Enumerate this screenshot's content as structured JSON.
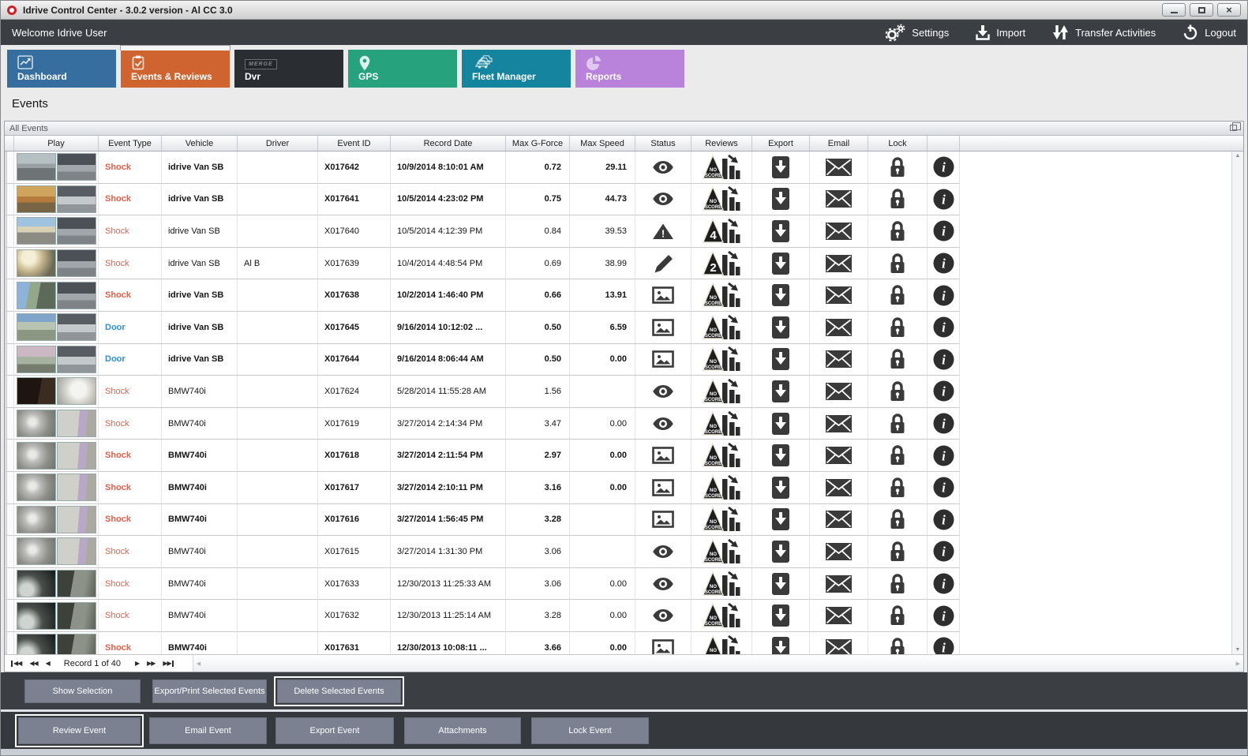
{
  "window": {
    "title": "Idrive Control Center - 3.0.2 version - Al CC 3.0",
    "controls": {
      "minimize": "minimize-button",
      "maximize": "maximize-button",
      "close": "close-button"
    }
  },
  "topbar": {
    "welcome": "Welcome Idrive User",
    "actions": [
      {
        "label": "Settings",
        "icon": "gears-icon"
      },
      {
        "label": "Import",
        "icon": "import-arrow-icon"
      },
      {
        "label": "Transfer Activities",
        "icon": "transfer-arrows-icon"
      },
      {
        "label": "Logout",
        "icon": "power-icon"
      }
    ]
  },
  "tabs": [
    {
      "label": "Dashboard",
      "icon": "line-chart-icon",
      "color": "#366f9f",
      "active": false
    },
    {
      "label": "Events & Reviews",
      "icon": "clipboard-check-icon",
      "color": "#cf6430",
      "active": true
    },
    {
      "label": "Dvr",
      "icon": "merge-logo-icon",
      "color": "#2a2d32",
      "active": false
    },
    {
      "label": "GPS",
      "icon": "map-pin-icon",
      "color": "#26a37d",
      "active": false
    },
    {
      "label": "Fleet Manager",
      "icon": "cars-icon",
      "color": "#15849e",
      "active": false
    },
    {
      "label": "Reports",
      "icon": "pie-chart-icon",
      "color": "#b983dc",
      "active": false
    }
  ],
  "page": {
    "heading": "Events",
    "panel_title": "All Events"
  },
  "table": {
    "columns": [
      "Play",
      "Event Type",
      "Vehicle",
      "Driver",
      "Event ID",
      "Record Date",
      "Max G-Force",
      "Max Speed",
      "Status",
      "Reviews",
      "Export",
      "Email",
      "Lock"
    ],
    "event_type_colors": {
      "Shock": "#e2604a",
      "Door": "#2e8fd2"
    },
    "row_icons": {
      "export": "download-icon",
      "email": "envelope-icon",
      "lock": "padlock-icon",
      "info": "info-icon"
    },
    "status_icons": [
      "eye",
      "warning",
      "pencil",
      "picture"
    ],
    "rows": [
      {
        "event_type": "Shock",
        "bold": true,
        "vehicle": "idrive Van SB",
        "driver": "",
        "event_id": "X017642",
        "record_date": "10/9/2014 8:10:01 AM",
        "max_g": "0.72",
        "max_speed": "29.11",
        "status": "eye",
        "review": "NO SCORE",
        "thumbs": [
          "t-road-gray",
          "t-cab"
        ]
      },
      {
        "event_type": "Shock",
        "bold": true,
        "vehicle": "idrive Van SB",
        "driver": "",
        "event_id": "X017641",
        "record_date": "10/5/2014 4:23:02 PM",
        "max_g": "0.75",
        "max_speed": "44.73",
        "status": "eye",
        "review": "NO SCORE",
        "thumbs": [
          "t-road-autumn",
          "t-cab-bright"
        ]
      },
      {
        "event_type": "Shock",
        "bold": false,
        "vehicle": "idrive Van SB",
        "driver": "",
        "event_id": "X017640",
        "record_date": "10/5/2014 4:12:39 PM",
        "max_g": "0.84",
        "max_speed": "39.53",
        "status": "warning",
        "review": "4",
        "thumbs": [
          "t-road-sunny",
          "t-cab"
        ]
      },
      {
        "event_type": "Shock",
        "bold": false,
        "vehicle": "idrive Van SB",
        "driver": "Al B",
        "event_id": "X017639",
        "record_date": "10/4/2014 4:48:54 PM",
        "max_g": "0.69",
        "max_speed": "38.99",
        "status": "pencil",
        "review": "2",
        "thumbs": [
          "t-road-glare",
          "t-cab"
        ]
      },
      {
        "event_type": "Shock",
        "bold": true,
        "vehicle": "idrive Van SB",
        "driver": "",
        "event_id": "X017638",
        "record_date": "10/2/2014 1:46:40 PM",
        "max_g": "0.66",
        "max_speed": "13.91",
        "status": "picture",
        "review": "NO SCORE",
        "thumbs": [
          "t-road-shade",
          "t-cab"
        ]
      },
      {
        "event_type": "Door",
        "bold": true,
        "vehicle": "idrive Van SB",
        "driver": "",
        "event_id": "X017645",
        "record_date": "9/16/2014 10:12:02 ...",
        "max_g": "0.50",
        "max_speed": "6.59",
        "status": "picture",
        "review": "NO SCORE",
        "thumbs": [
          "t-yard",
          "t-cab-bright"
        ]
      },
      {
        "event_type": "Door",
        "bold": true,
        "vehicle": "idrive Van SB",
        "driver": "",
        "event_id": "X017644",
        "record_date": "9/16/2014 8:06:44 AM",
        "max_g": "0.50",
        "max_speed": "0.00",
        "status": "picture",
        "review": "NO SCORE",
        "thumbs": [
          "t-yard2",
          "t-cab-bright"
        ]
      },
      {
        "event_type": "Shock",
        "bold": false,
        "vehicle": "BMW740i",
        "driver": "",
        "event_id": "X017624",
        "record_date": "5/28/2014 11:55:28 AM",
        "max_g": "1.56",
        "max_speed": "",
        "status": "eye",
        "review": "NO SCORE",
        "thumbs": [
          "t-dark-brown",
          "t-room-flash"
        ]
      },
      {
        "event_type": "Shock",
        "bold": false,
        "vehicle": "BMW740i",
        "driver": "",
        "event_id": "X017619",
        "record_date": "3/27/2014 2:14:34 PM",
        "max_g": "3.47",
        "max_speed": "0.00",
        "status": "eye",
        "review": "NO SCORE",
        "thumbs": [
          "t-sparkle",
          "t-room-person"
        ]
      },
      {
        "event_type": "Shock",
        "bold": true,
        "vehicle": "BMW740i",
        "driver": "",
        "event_id": "X017618",
        "record_date": "3/27/2014 2:11:54 PM",
        "max_g": "2.97",
        "max_speed": "0.00",
        "status": "picture",
        "review": "NO SCORE",
        "thumbs": [
          "t-sparkle",
          "t-room-person"
        ]
      },
      {
        "event_type": "Shock",
        "bold": true,
        "vehicle": "BMW740i",
        "driver": "",
        "event_id": "X017617",
        "record_date": "3/27/2014 2:10:11 PM",
        "max_g": "3.16",
        "max_speed": "0.00",
        "status": "picture",
        "review": "NO SCORE",
        "thumbs": [
          "t-sparkle",
          "t-room-person"
        ]
      },
      {
        "event_type": "Shock",
        "bold": true,
        "vehicle": "BMW740i",
        "driver": "",
        "event_id": "X017616",
        "record_date": "3/27/2014 1:56:45 PM",
        "max_g": "3.28",
        "max_speed": "",
        "status": "picture",
        "review": "NO SCORE",
        "thumbs": [
          "t-sparkle",
          "t-room-person"
        ]
      },
      {
        "event_type": "Shock",
        "bold": false,
        "vehicle": "BMW740i",
        "driver": "",
        "event_id": "X017615",
        "record_date": "3/27/2014 1:31:30 PM",
        "max_g": "3.06",
        "max_speed": "",
        "status": "eye",
        "review": "NO SCORE",
        "thumbs": [
          "t-sparkle",
          "t-room-person"
        ]
      },
      {
        "event_type": "Shock",
        "bold": false,
        "vehicle": "BMW740i",
        "driver": "",
        "event_id": "X017633",
        "record_date": "12/30/2013 11:25:33 AM",
        "max_g": "3.06",
        "max_speed": "0.00",
        "status": "eye",
        "review": "NO SCORE",
        "thumbs": [
          "t-dark-room",
          "t-dim-room"
        ]
      },
      {
        "event_type": "Shock",
        "bold": false,
        "vehicle": "BMW740i",
        "driver": "",
        "event_id": "X017632",
        "record_date": "12/30/2013 11:25:14 AM",
        "max_g": "3.28",
        "max_speed": "0.00",
        "status": "eye",
        "review": "NO SCORE",
        "thumbs": [
          "t-dark-room",
          "t-dim-room"
        ]
      },
      {
        "event_type": "Shock",
        "bold": true,
        "vehicle": "BMW740i",
        "driver": "",
        "event_id": "X017631",
        "record_date": "12/30/2013 10:08:11 ...",
        "max_g": "3.66",
        "max_speed": "0.00",
        "status": "picture",
        "review": "NO SCORE",
        "thumbs": [
          "t-dark-room",
          "t-dim-room"
        ]
      }
    ]
  },
  "pagination": {
    "record_label": "Record 1 of 40"
  },
  "panels": {
    "selection_buttons": [
      {
        "label": "Show Selection",
        "focused": false
      },
      {
        "label": "Export/Print Selected Events",
        "focused": false
      },
      {
        "label": "Delete Selected  Events",
        "focused": true
      }
    ],
    "event_buttons": [
      {
        "label": "Review Event",
        "focused": true
      },
      {
        "label": "Email Event",
        "focused": false
      },
      {
        "label": "Export Event",
        "focused": false
      },
      {
        "label": "Attachments",
        "focused": false
      },
      {
        "label": "Lock Event",
        "focused": false
      }
    ]
  }
}
